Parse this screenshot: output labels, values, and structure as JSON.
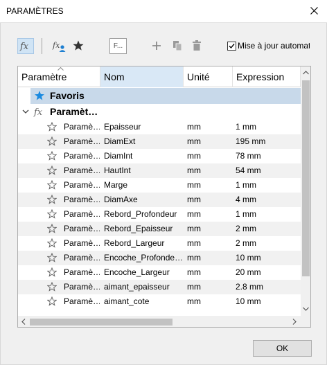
{
  "window": {
    "title": "PARAMÈTRES"
  },
  "toolbar": {
    "filter_label": "F...",
    "auto_update_label": "Mise à jour automatique",
    "auto_update_checked": true
  },
  "grid": {
    "columns": [
      "Paramètre",
      "Nom",
      "Unité",
      "Expression"
    ],
    "sorted_column": "Nom",
    "favorites_label": "Favoris",
    "group_label": "Paramèt…",
    "rows": [
      {
        "param": "Paramè…",
        "name": "Epaisseur",
        "unit": "mm",
        "expr": "1 mm"
      },
      {
        "param": "Paramè…",
        "name": "DiamExt",
        "unit": "mm",
        "expr": "195 mm"
      },
      {
        "param": "Paramè…",
        "name": "DiamInt",
        "unit": "mm",
        "expr": "78 mm"
      },
      {
        "param": "Paramè…",
        "name": "HautInt",
        "unit": "mm",
        "expr": "54 mm"
      },
      {
        "param": "Paramè…",
        "name": "Marge",
        "unit": "mm",
        "expr": "1 mm"
      },
      {
        "param": "Paramè…",
        "name": "DiamAxe",
        "unit": "mm",
        "expr": "4 mm"
      },
      {
        "param": "Paramè…",
        "name": "Rebord_Profondeur",
        "unit": "mm",
        "expr": "1 mm"
      },
      {
        "param": "Paramè…",
        "name": "Rebord_Epaisseur",
        "unit": "mm",
        "expr": "2 mm"
      },
      {
        "param": "Paramè…",
        "name": "Rebord_Largeur",
        "unit": "mm",
        "expr": "2 mm"
      },
      {
        "param": "Paramè…",
        "name": "Encoche_Profonde…",
        "unit": "mm",
        "expr": "10 mm"
      },
      {
        "param": "Paramè…",
        "name": "Encoche_Largeur",
        "unit": "mm",
        "expr": "20 mm"
      },
      {
        "param": "Paramè…",
        "name": "aimant_epaisseur",
        "unit": "mm",
        "expr": "2.8 mm"
      },
      {
        "param": "Paramè…",
        "name": "aimant_cote",
        "unit": "mm",
        "expr": "10 mm"
      }
    ]
  },
  "footer": {
    "ok_label": "OK"
  },
  "colors": {
    "selection": "#c8d9ea",
    "accent": "#0a84d8"
  }
}
